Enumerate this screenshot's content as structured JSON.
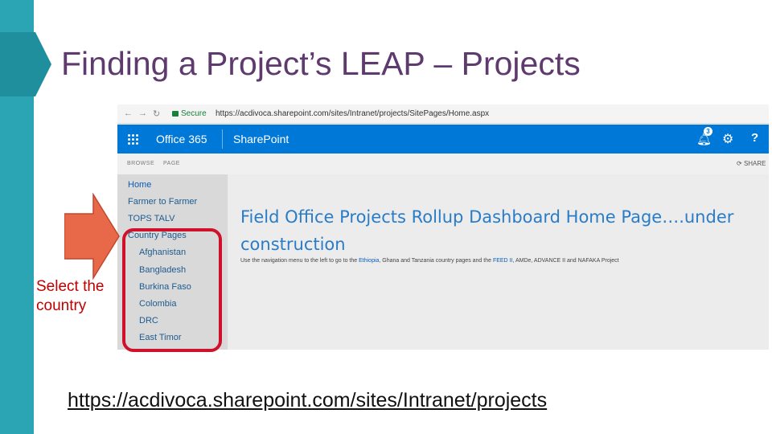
{
  "slide": {
    "title": "Finding a Project’s LEAP – Projects",
    "callout": "Select the country",
    "link": "https://acdivoca.sharepoint.com/sites/Intranet/projects",
    "colors": {
      "sidebar": "#2ba4b3",
      "title": "#5e3a6e",
      "highlight": "#d0112b",
      "arrow": "#e8694a"
    }
  },
  "browser": {
    "back": "←",
    "forward": "→",
    "reload": "↻",
    "secure_label": "Secure",
    "url": "https://acdivoca.sharepoint.com/sites/Intranet/projects/SitePages/Home.aspx"
  },
  "suitebar": {
    "app_launcher_icon": "waffle-icon",
    "office_label": "Office 365",
    "sharepoint_label": "SharePoint",
    "notification_icon": "bell-icon",
    "notification_count": "3",
    "settings_icon": "gear-icon",
    "help_label": "?",
    "color": "#0078d7"
  },
  "commandbar": {
    "browse_label": "BROWSE",
    "page_label": "PAGE",
    "share_label": "SHARE"
  },
  "leftnav": {
    "items": [
      {
        "label": "Home"
      },
      {
        "label": "Farmer to Farmer"
      },
      {
        "label": "TOPS TALV"
      },
      {
        "label": "Country Pages"
      },
      {
        "label": "Afghanistan"
      },
      {
        "label": "Bangladesh"
      },
      {
        "label": "Burkina Faso"
      },
      {
        "label": "Colombia"
      },
      {
        "label": "DRC"
      },
      {
        "label": "East Timor"
      }
    ]
  },
  "content": {
    "heading": "Field Office Projects Rollup Dashboard Home Page….under construction",
    "desc_pre": "Use the navigation menu to the left to go to the ",
    "desc_link1": "Ethiopia",
    "desc_mid": ", Ghana and Tanzania country pages and the ",
    "desc_link2": "FEED II",
    "desc_post": ", AMDe, ADVANCE II and NAFAKA Project"
  }
}
